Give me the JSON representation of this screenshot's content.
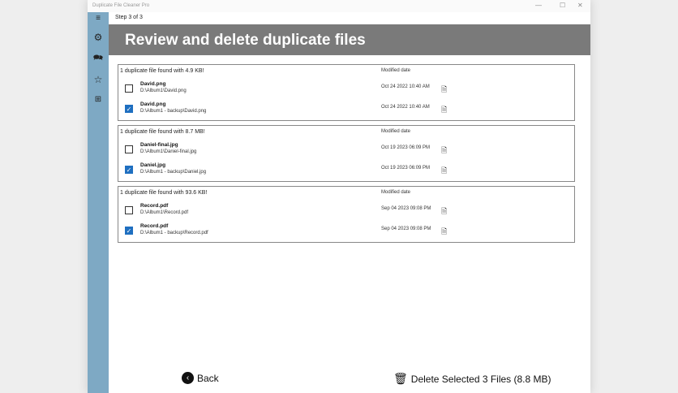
{
  "window": {
    "title": "Duplicate File Cleaner Pro",
    "minimize": "—",
    "maximize": "☐",
    "close": "✕"
  },
  "step": "Step 3 of 3",
  "header": "Review and delete duplicate files",
  "modified_label": "Modified date",
  "groups": [
    {
      "title": "1 duplicate file found with 4.9 KB!",
      "files": [
        {
          "name": "David.png",
          "path": "D:\\Album1\\David.png",
          "date": "Oct 24 2022 10:40 AM",
          "checked": false
        },
        {
          "name": "David.png",
          "path": "D:\\Album1 - backup\\David.png",
          "date": "Oct 24 2022 10:40 AM",
          "checked": true
        }
      ]
    },
    {
      "title": "1 duplicate file found with 8.7 MB!",
      "files": [
        {
          "name": "Daniel-final.jpg",
          "path": "D:\\Album1\\Daniel-final.jpg",
          "date": "Oct 19 2023 06:09 PM",
          "checked": false
        },
        {
          "name": "Daniel.jpg",
          "path": "D:\\Album1 - backup\\Daniel.jpg",
          "date": "Oct 19 2023 06:09 PM",
          "checked": true
        }
      ]
    },
    {
      "title": "1 duplicate file found with 93.6 KB!",
      "files": [
        {
          "name": "Record.pdf",
          "path": "D:\\Album1\\Record.pdf",
          "date": "Sep 04 2023 09:08 PM",
          "checked": false
        },
        {
          "name": "Record.pdf",
          "path": "D:\\Album1 - backup\\Record.pdf",
          "date": "Sep 04 2023 09:08 PM",
          "checked": true
        }
      ]
    }
  ],
  "footer": {
    "back": "Back",
    "delete": "Delete Selected 3 Files (8.8 MB)"
  }
}
